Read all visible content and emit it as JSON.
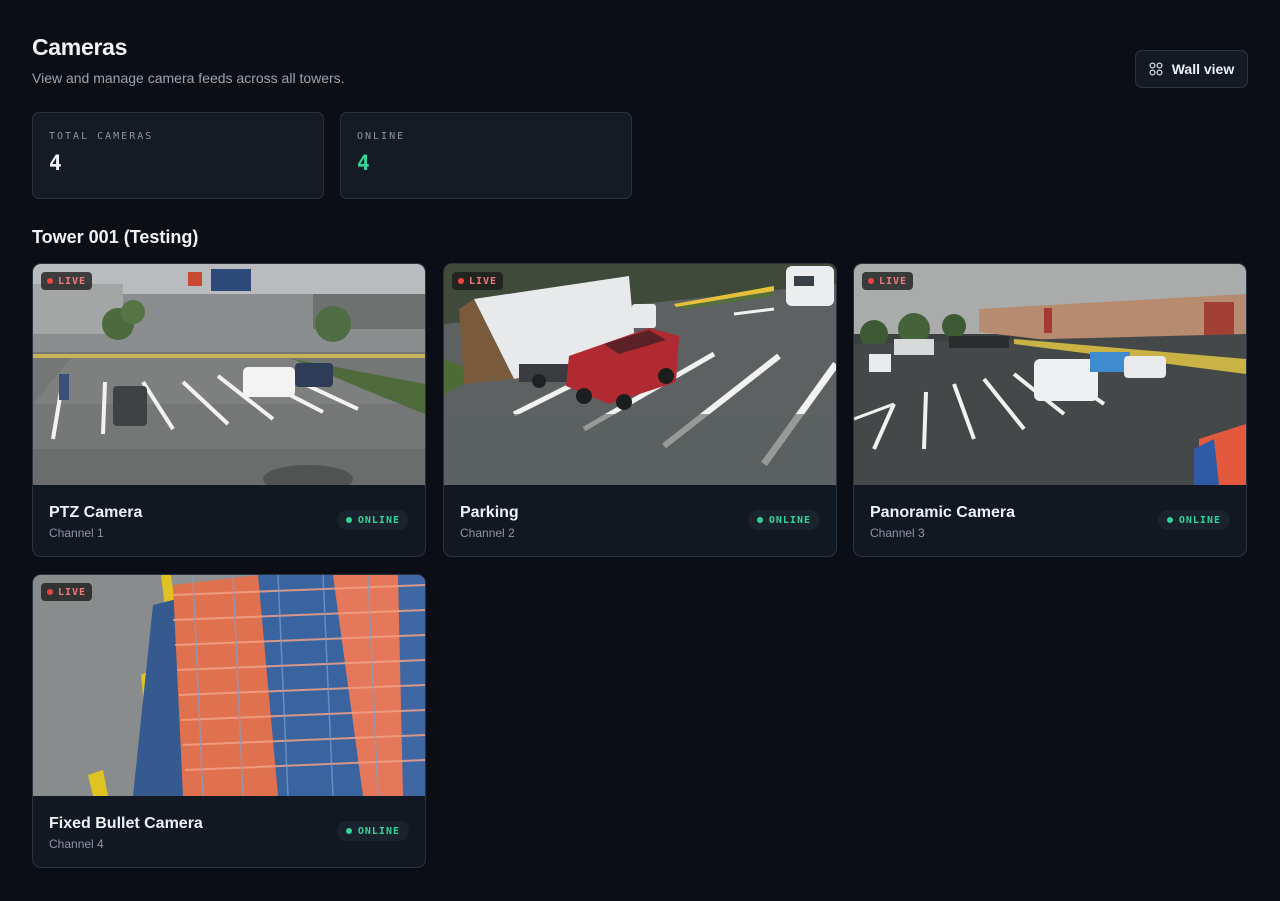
{
  "header": {
    "title": "Cameras",
    "subtitle": "View and manage camera feeds across all towers.",
    "wall_view_label": "Wall view"
  },
  "stats": [
    {
      "label": "TOTAL CAMERAS",
      "value": "4",
      "color": "#f1f3f6"
    },
    {
      "label": "ONLINE",
      "value": "4",
      "color": "#34d399"
    }
  ],
  "tower": {
    "title": "Tower 001 (Testing)",
    "cameras": [
      {
        "name": "PTZ Camera",
        "channel": "Channel 1",
        "live_label": "LIVE",
        "status": "ONLINE",
        "scene": "parking-lot-ptz"
      },
      {
        "name": "Parking",
        "channel": "Channel 2",
        "live_label": "LIVE",
        "status": "ONLINE",
        "scene": "parking-trucks"
      },
      {
        "name": "Panoramic Camera",
        "channel": "Channel 3",
        "live_label": "LIVE",
        "status": "ONLINE",
        "scene": "parking-panoramic"
      },
      {
        "name": "Fixed Bullet Camera",
        "channel": "Channel 4",
        "live_label": "LIVE",
        "status": "ONLINE",
        "scene": "shopping-carts"
      }
    ]
  },
  "colors": {
    "background": "#0b0f15",
    "card": "#121821",
    "border": "#2a3340",
    "online": "#34d399",
    "live": "#ef4444"
  }
}
